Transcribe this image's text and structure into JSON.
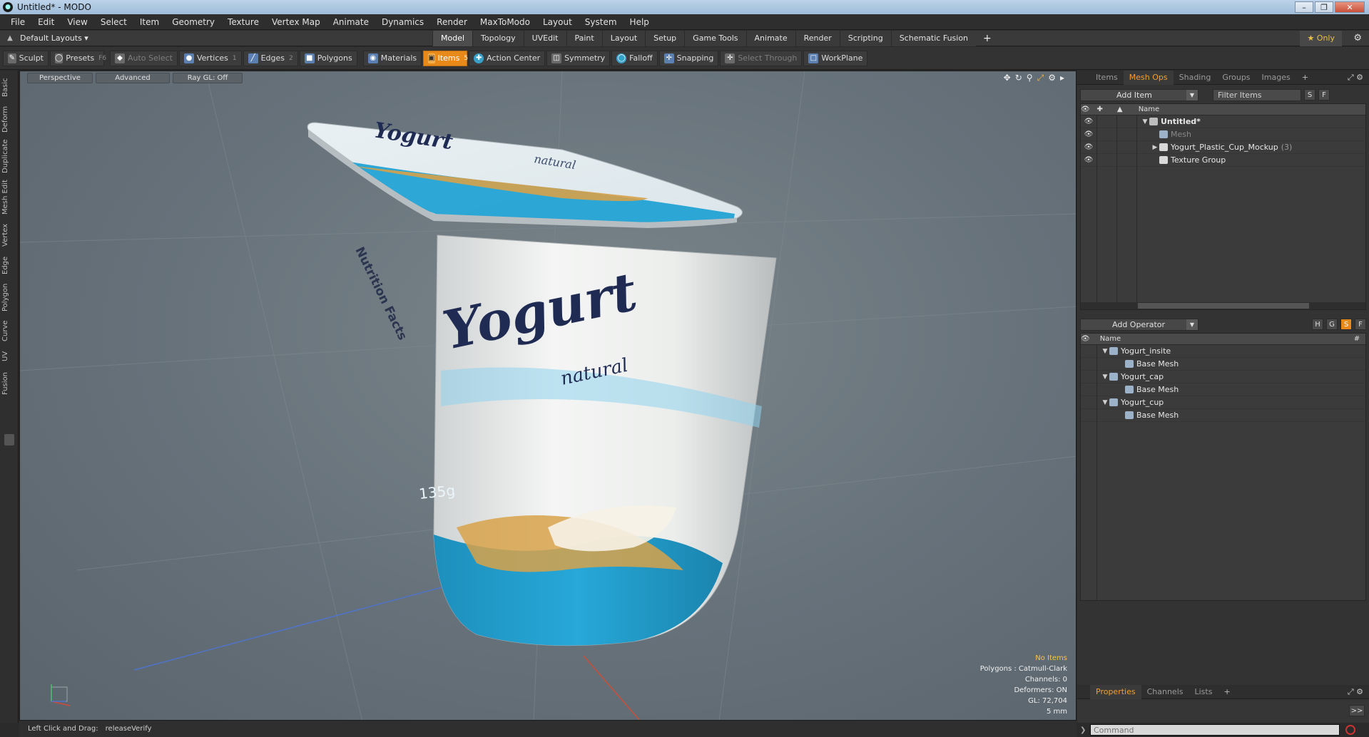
{
  "window": {
    "title": "Untitled* - MODO",
    "app_icon": "modo-logo-icon"
  },
  "menu": [
    "File",
    "Edit",
    "View",
    "Select",
    "Item",
    "Geometry",
    "Texture",
    "Vertex Map",
    "Animate",
    "Dynamics",
    "Render",
    "MaxToModo",
    "Layout",
    "System",
    "Help"
  ],
  "layoutbar": {
    "layouts_label": "Default Layouts ▾",
    "tabs": [
      "Model",
      "Topology",
      "UVEdit",
      "Paint",
      "Layout",
      "Setup",
      "Game Tools",
      "Animate",
      "Render",
      "Scripting",
      "Schematic Fusion"
    ],
    "active_tab": "Model",
    "only_label": "★ Only"
  },
  "toolbar": {
    "sculpt": "Sculpt",
    "presets": "Presets",
    "presets_key": "F6",
    "auto_select": "Auto Select",
    "vertices": "Vertices",
    "vertices_key": "1",
    "edges": "Edges",
    "edges_key": "2",
    "polygons": "Polygons",
    "materials": "Materials",
    "items": "Items",
    "items_key": "5",
    "action_center": "Action Center",
    "symmetry": "Symmetry",
    "falloff": "Falloff",
    "snapping": "Snapping",
    "select_through": "Select Through",
    "workplane": "WorkPlane"
  },
  "leftbar": [
    "Basic",
    "Deform",
    "Duplicate",
    "Mesh Edit",
    "Vertex",
    "Edge",
    "Polygon",
    "Curve",
    "UV",
    "Fusion"
  ],
  "viewport": {
    "perspective": "Perspective",
    "advanced": "Advanced",
    "raygl": "Ray GL: Off",
    "info": {
      "no_items": "No Items",
      "polygons": "Polygons : Catmull-Clark",
      "channels": "Channels: 0",
      "deformers": "Deformers: ON",
      "gl": "GL: 72,704",
      "scale": "5 mm"
    },
    "model": {
      "brand": "Yogurt",
      "brand_lid": "Yogurt",
      "variant": "natural",
      "variant_lid": "natural",
      "nutrition": "Nutrition Facts",
      "weight": "135g",
      "colors": {
        "blue": "#22a3d4",
        "white": "#f2f3f2",
        "navy": "#1f2b52",
        "honey": "#d7a24a"
      }
    }
  },
  "statusbar": {
    "hint": "Left Click and Drag:",
    "action": "releaseVerify"
  },
  "rightpanel": {
    "tabs_top": [
      "Items",
      "Mesh Ops",
      "Shading",
      "Groups",
      "Images",
      "+"
    ],
    "active_top": "Mesh Ops",
    "add_item": "Add Item",
    "filter_items": "Filter Items",
    "btn_s": "S",
    "btn_f": "F",
    "name_header": "Name",
    "items": [
      {
        "label": "Untitled*",
        "count": "",
        "style": "bold",
        "indent": 0,
        "expand": "▼",
        "icon": "folder"
      },
      {
        "label": "Mesh",
        "count": "",
        "style": "dim",
        "indent": 1,
        "expand": "",
        "icon": "mesh"
      },
      {
        "label": "Yogurt_Plastic_Cup_Mockup",
        "count": "(3)",
        "style": "",
        "indent": 1,
        "expand": "▶",
        "icon": "group"
      },
      {
        "label": "Texture Group",
        "count": "",
        "style": "",
        "indent": 1,
        "expand": "",
        "icon": "group"
      }
    ],
    "add_operator": "Add Operator",
    "op_buttons": [
      "H",
      "G",
      "S",
      "F"
    ],
    "ops_header": "Name",
    "ops_hash": "#",
    "operators": [
      {
        "label": "Yogurt_insite",
        "indent": 0,
        "expand": "▼"
      },
      {
        "label": "Base Mesh",
        "indent": 1,
        "expand": ""
      },
      {
        "label": "Yogurt_cap",
        "indent": 0,
        "expand": "▼"
      },
      {
        "label": "Base Mesh",
        "indent": 1,
        "expand": ""
      },
      {
        "label": "Yogurt_cup",
        "indent": 0,
        "expand": "▼"
      },
      {
        "label": "Base Mesh",
        "indent": 1,
        "expand": ""
      }
    ],
    "tabs_bottom": [
      "Properties",
      "Channels",
      "Lists",
      "+"
    ],
    "active_bottom": "Properties",
    "command_placeholder": "Command",
    "expand_btn": ">>"
  }
}
